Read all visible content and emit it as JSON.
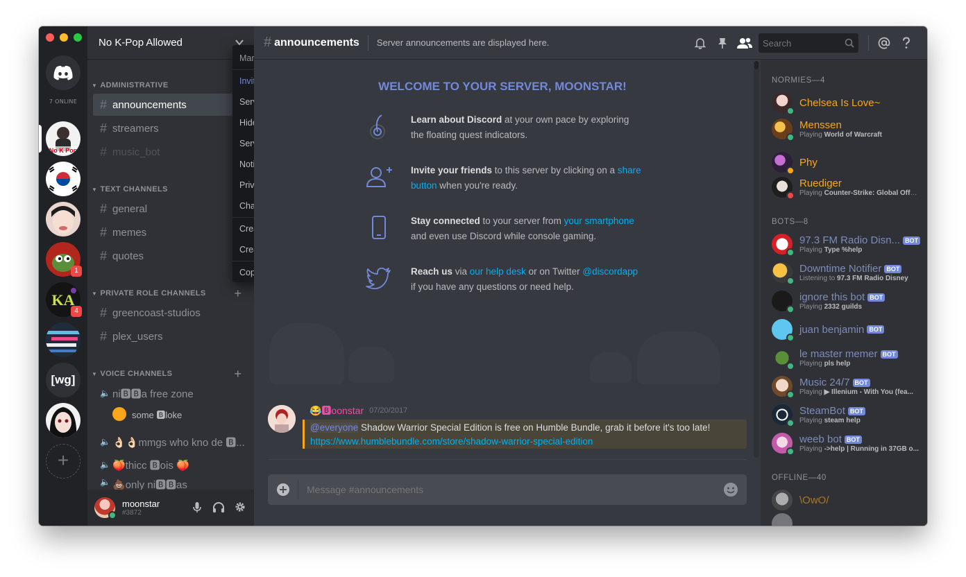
{
  "server": {
    "name": "No K-Pop Allowed",
    "online_label": "7 ONLINE",
    "badges": [
      "1",
      "4"
    ],
    "wg_label": "[wg]"
  },
  "channels": {
    "categories": {
      "administrative": "ADMINISTRATIVE",
      "text": "TEXT CHANNELS",
      "private": "PRIVATE ROLE CHANNELS",
      "voice": "VOICE CHANNELS"
    },
    "administrative": [
      "announcements",
      "streamers",
      "music_bot"
    ],
    "text": [
      "general",
      "memes",
      "quotes"
    ],
    "private": [
      "greencoast-studios",
      "plex_users"
    ],
    "voice": [
      "ni🅱🅱a free zone",
      "👌🏻👌🏻mmgs who kno de 🅱...",
      "🍑thicc 🅱ois 🍑",
      "💩only ni🅱🅱as"
    ],
    "voice_user": "some 🅱loke"
  },
  "user": {
    "name": "moonstar",
    "tag": "#3872"
  },
  "header": {
    "channel": "announcements",
    "topic": "Server announcements are displayed here.",
    "search_placeholder": "Search"
  },
  "welcome": {
    "title": "WELCOME TO YOUR SERVER, MOONSTAR!",
    "tip1_bold": "Learn about Discord",
    "tip1_rest": " at your own pace by exploring the floating quest indicators.",
    "tip2_bold": "Invite your friends",
    "tip2_rest": " to this server by clicking on a ",
    "tip2_link": "share button",
    "tip2_end": " when you're ready.",
    "tip3_bold": "Stay connected",
    "tip3_rest": " to your server from ",
    "tip3_link": "your smartphone",
    "tip3_end": " and even use Discord while console gaming.",
    "tip4_bold": "Reach us",
    "tip4_rest": " via ",
    "tip4_link": "our help desk",
    "tip4_mid": " or on Twitter ",
    "tip4_link2": "@discordapp",
    "tip4_end": " if you have any questions or need help."
  },
  "message": {
    "author": "😂🅱oonstar",
    "timestamp": "07/20/2017",
    "mention": "@everyone",
    "text": " Shadow Warrior Special Edition is free on Humble Bundle, grab it before it's too late! ",
    "link": "https://www.humblebundle.com/store/shadow-warrior-special-edition"
  },
  "composer": {
    "placeholder": "Message #announcements"
  },
  "context_menu": [
    "Mark As Read",
    "Invite People",
    "Server Mute",
    "Hide Muted Channels",
    "Server Settings",
    "Notification Settings",
    "Privacy Settings",
    "Change Nickname",
    "Create Channel",
    "Create Category",
    "Copy ID"
  ],
  "members": {
    "normies_header": "NORMIES—4",
    "bots_header": "BOTS—8",
    "offline_header": "OFFLINE—40",
    "bot_tag": "BOT",
    "normies": [
      {
        "name": "Chelsea Is Love~",
        "activity_prefix": "",
        "activity": ""
      },
      {
        "name": "Menssen",
        "activity_prefix": "Playing ",
        "activity": "World of Warcraft"
      },
      {
        "name": "Phy",
        "activity_prefix": "",
        "activity": ""
      },
      {
        "name": "Ruediger",
        "activity_prefix": "Playing ",
        "activity": "Counter-Strike: Global Offe..."
      }
    ],
    "bots": [
      {
        "name": "97.3 FM Radio Disn...",
        "activity_prefix": "Playing ",
        "activity": "Type %help"
      },
      {
        "name": "Downtime Notifier",
        "activity_prefix": "Listening to ",
        "activity": "97.3 FM Radio Disney"
      },
      {
        "name": "ignore this bot",
        "activity_prefix": "Playing ",
        "activity": "2332 guilds"
      },
      {
        "name": "juan benjamin",
        "activity_prefix": "",
        "activity": ""
      },
      {
        "name": "le master memer",
        "activity_prefix": "Playing ",
        "activity": "pls help"
      },
      {
        "name": "Music 24/7",
        "activity_prefix": "Playing ",
        "activity": "▶ Illenium - With You (fea..."
      },
      {
        "name": "SteamBot",
        "activity_prefix": "Playing ",
        "activity": "steam help"
      },
      {
        "name": "weeb bot",
        "activity_prefix": "Playing ",
        "activity": "->help | Running in 37GB o..."
      }
    ],
    "offline": [
      {
        "name": "\\OwO/"
      }
    ]
  },
  "colors": {
    "normie_name": "#faa61a",
    "bot_name": "#7d8cb9",
    "online": "#43b581",
    "idle": "#faa61a",
    "dnd": "#f04747",
    "accent": "#7289da"
  }
}
